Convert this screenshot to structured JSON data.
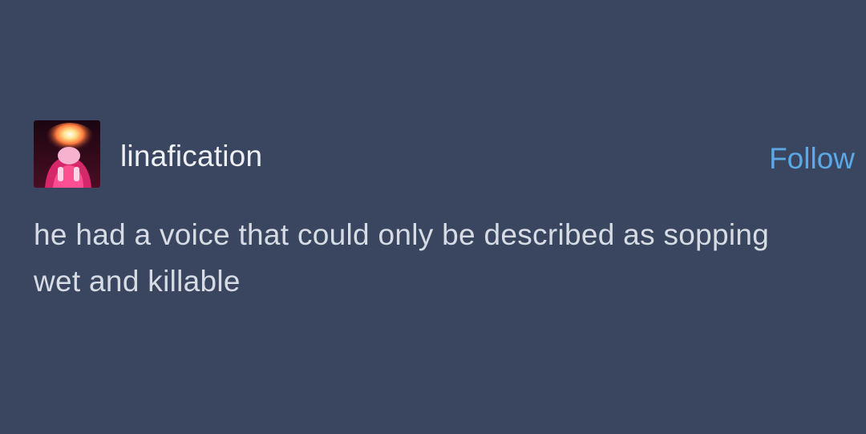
{
  "post": {
    "username": "linafication",
    "follow_label": "Follow",
    "text": "he had a voice that could only be described as sopping wet and killable",
    "avatar_icon": "avatar-image"
  },
  "colors": {
    "background": "#3a4660",
    "username": "#eef0f4",
    "body_text": "#d7dbe3",
    "follow": "#5aa9e6"
  }
}
